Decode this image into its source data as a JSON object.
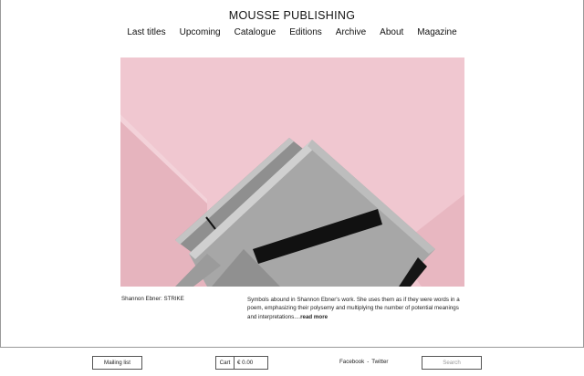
{
  "site": {
    "title": "MOUSSE PUBLISHING"
  },
  "nav": {
    "items": [
      "Last titles",
      "Upcoming",
      "Catalogue",
      "Editions",
      "Archive",
      "About",
      "Magazine"
    ]
  },
  "feature": {
    "title": "Shannon Ebner: STRIKE",
    "description": "Symbols abound in Shannon Ebner's work. She uses them as if they were words in a poem, emphasizing their polysemy and multiplying the number of potential meanings and interpretations....",
    "read_more": "read more"
  },
  "footer": {
    "mailing_list": "Mailing list",
    "cart_label": "Cart",
    "cart_total": "€ 0.00",
    "facebook": "Facebook",
    "separator": "-",
    "twitter": "Twitter",
    "search_placeholder": "Search"
  }
}
